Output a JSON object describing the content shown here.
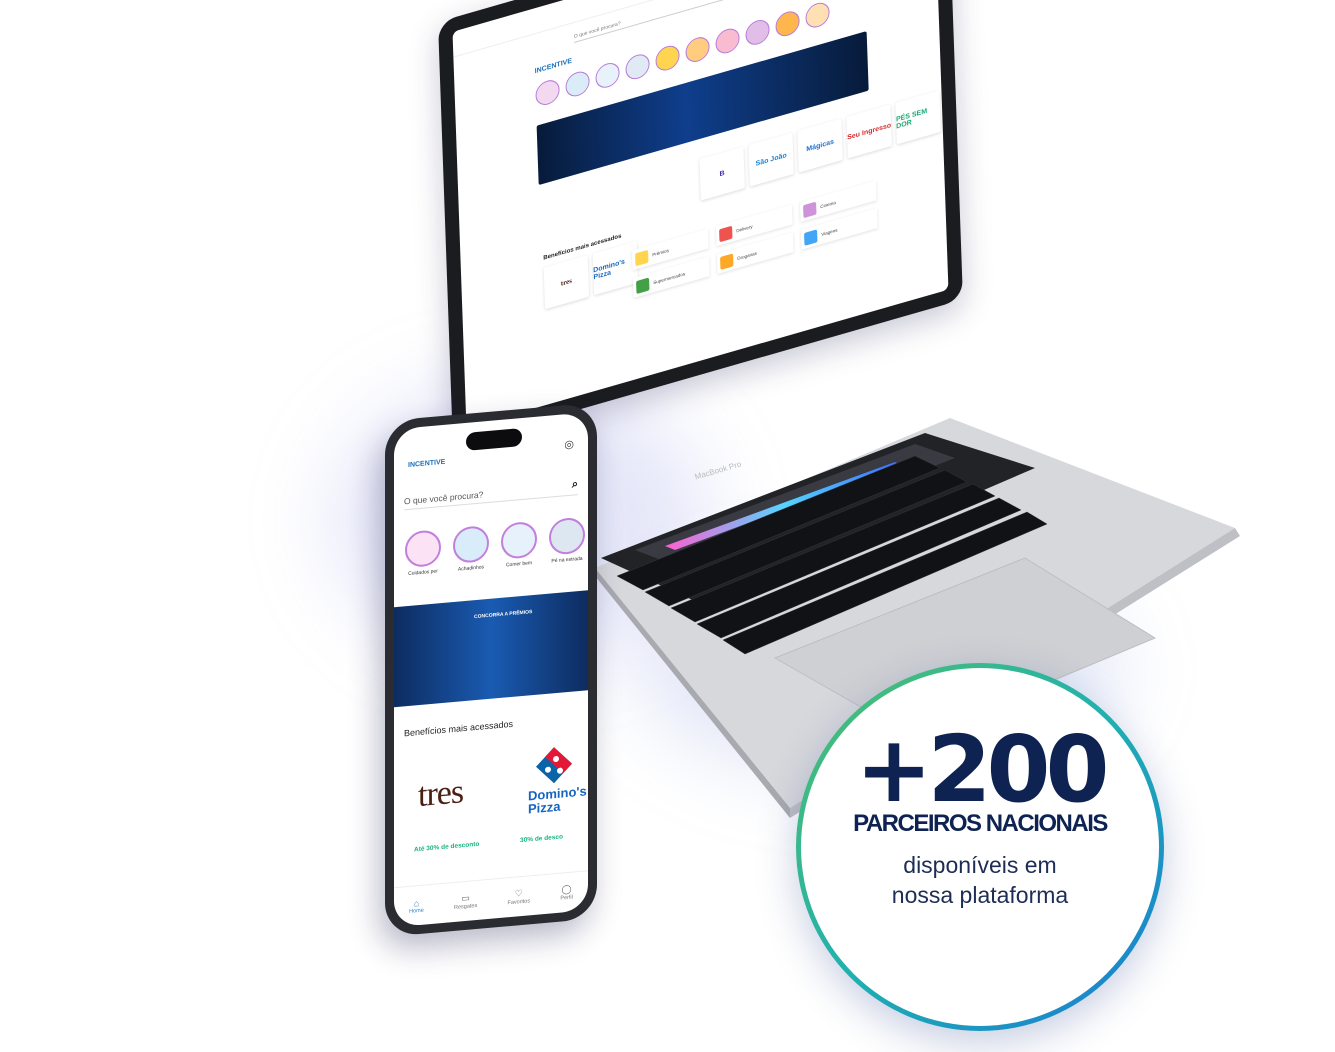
{
  "laptop": {
    "logo": "INCENTIVE",
    "search_placeholder": "O que você procura?",
    "section_title": "Benefícios mais acessados",
    "brand": "MacBook Pro",
    "partners": [
      "tres",
      "Domino's Pizza",
      "B",
      "São João",
      "Mágicas",
      "Seu Ingresso",
      "PÉS SEM DOR"
    ],
    "tiles": [
      "Prêmios",
      "Delivery",
      "Cinema",
      "Supermercados",
      "Drogarias",
      "Viagens"
    ]
  },
  "phone": {
    "logo": "INCENTIVE",
    "search_placeholder": "O que você procura?",
    "categories": [
      "Cuidados per",
      "Achadinhos",
      "Comer bem",
      "Pé na estrada"
    ],
    "banner_text": "CONCORRA A PRÊMIOS",
    "section_title": "Benefícios mais acessados",
    "card1": {
      "brand": "tres",
      "offer": "Até 30% de desconto"
    },
    "card2": {
      "brand_line1": "Domino's",
      "brand_line2": "Pizza",
      "offer": "30% de desco"
    },
    "nav": [
      {
        "label": "Home",
        "icon": "home-icon",
        "glyph": "⌂"
      },
      {
        "label": "Resgates",
        "icon": "ticket-icon",
        "glyph": "▭"
      },
      {
        "label": "Favoritos",
        "icon": "heart-icon",
        "glyph": "♡"
      },
      {
        "label": "Perfil",
        "icon": "profile-icon",
        "glyph": "◯"
      }
    ]
  },
  "badge": {
    "number": "+200",
    "title": "PARCEIROS NACIONAIS",
    "subtitle_line1": "disponíveis em",
    "subtitle_line2": "nossa plataforma"
  },
  "colors": {
    "navy": "#0f2352",
    "ring_start": "#52c06b",
    "ring_end": "#1a7ad4",
    "offer_green": "#18b57d",
    "accent_blue": "#1f7fd0"
  }
}
